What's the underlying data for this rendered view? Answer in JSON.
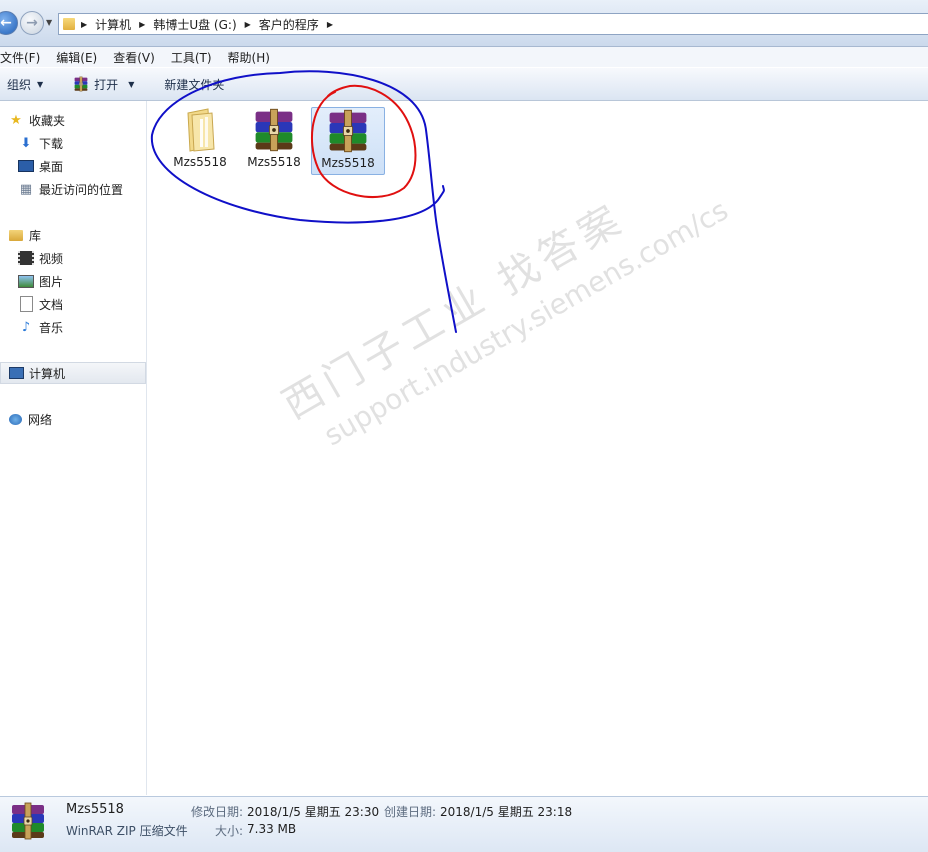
{
  "address": {
    "crumbs": [
      "计算机",
      "韩博士U盘 (G:)",
      "客户的程序"
    ]
  },
  "menu": [
    "文件(F)",
    "编辑(E)",
    "查看(V)",
    "工具(T)",
    "帮助(H)"
  ],
  "toolbar": {
    "organize": "组织",
    "open": "打开",
    "new_folder": "新建文件夹"
  },
  "nav": {
    "favorites": "收藏夹",
    "downloads": "下载",
    "desktop": "桌面",
    "recent": "最近访问的位置",
    "libraries": "库",
    "videos": "视频",
    "pictures": "图片",
    "documents": "文档",
    "music": "音乐",
    "computer": "计算机",
    "network": "网络"
  },
  "files": [
    {
      "name": "Mzs5518",
      "icon": "folder-icon"
    },
    {
      "name": "Mzs5518",
      "icon": "winrar-archive-icon"
    },
    {
      "name": "Mzs5518",
      "icon": "winrar-archive-icon",
      "selected": true
    }
  ],
  "status": {
    "name": "Mzs5518",
    "type": "WinRAR ZIP 压缩文件",
    "modified_label": "修改日期:",
    "modified_value": "2018/1/5 星期五 23:30",
    "created_label": "创建日期:",
    "created_value": "2018/1/5 星期五 23:18",
    "size_label": "大小:",
    "size_value": "7.33 MB"
  },
  "watermark": {
    "line1": "西门子工业   找答案",
    "line2": "support.industry.siemens.com/cs"
  },
  "colors": {
    "blue_annotation": "#1010c8",
    "red_annotation": "#e01010",
    "selection": "#cde0f7"
  }
}
